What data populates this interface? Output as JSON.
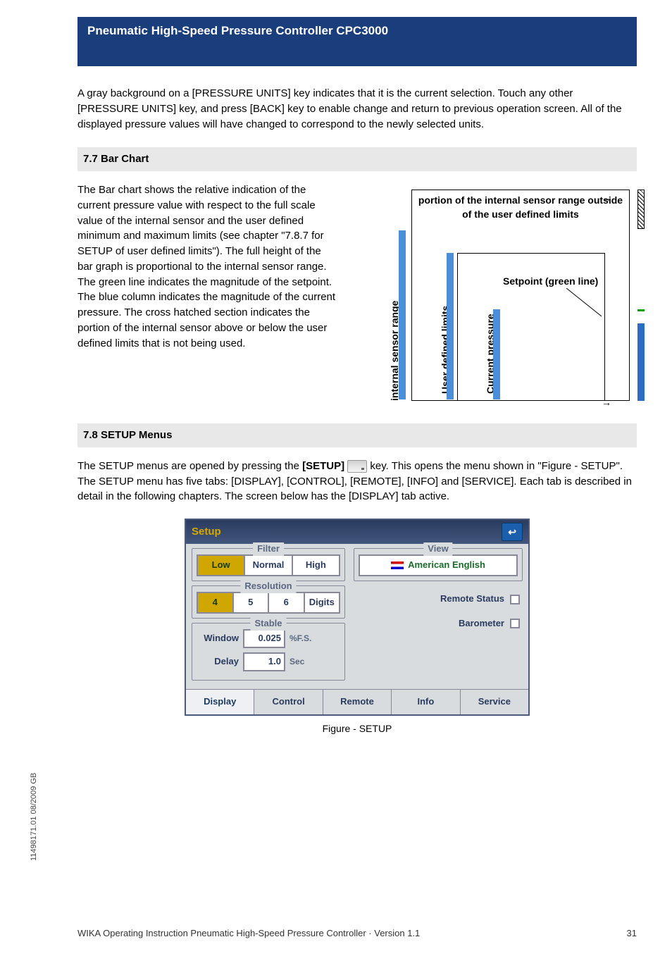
{
  "header": {
    "title": "Pneumatic High-Speed Pressure Controller CPC3000"
  },
  "body": {
    "intro": "A gray background on a [PRESSURE UNITS] key indicates that it is the current selection. Touch any other [PRESSURE UNITS] key, and press [BACK] key to enable change and return to previous operation screen. All of the displayed pressure values will have changed to correspond to the newly selected units.",
    "s77_heading": "7.7 Bar Chart",
    "s77_body": "The Bar chart shows the relative indication of the current pressure value with respect to the full scale value of the internal sensor and the user defined minimum and maximum limits (see chapter \"7.8.7 for SETUP of user defined limits\"). The full height of the bar graph is proportional to the internal sensor range. The green line indicates the magnitude of the setpoint. The blue column indicates the magnitude of the current pressure. The cross hatched section indicates the portion of the internal sensor above or below the user defined limits that is not being used.",
    "diagram": {
      "top": "portion of the internal sensor range outside of the user defined limits",
      "setpoint": "Setpoint (green line)",
      "internal": "internal sensor range",
      "user": "User defined limits",
      "current": "Current pressure"
    },
    "s78_heading": "7.8 SETUP Menus",
    "s78_body_before": "The SETUP menus are opened by pressing the ",
    "s78_body_key": "[SETUP]",
    "s78_body_after": " key. This opens the menu shown in \"Figure - SETUP\". The SETUP menu has five tabs: [DISPLAY], [CONTROL], [REMOTE], [INFO] and [SERVICE]. Each tab is described in detail in the following chapters. The screen below has the [DISPLAY] tab active."
  },
  "setup_ui": {
    "title": "Setup",
    "back_symbol": "↩",
    "filter_label": "Filter",
    "filter_options": [
      "Low",
      "Normal",
      "High"
    ],
    "filter_selected": "Low",
    "resolution_label": "Resolution",
    "resolution_options": [
      "4",
      "5",
      "6",
      "Digits"
    ],
    "resolution_selected": "4",
    "stable_label": "Stable",
    "window_label": "Window",
    "window_value": "0.025",
    "window_unit": "%F.S.",
    "delay_label": "Delay",
    "delay_value": "1.0",
    "delay_unit": "Sec",
    "view_label": "View",
    "language": "American English",
    "remote_status_label": "Remote Status",
    "barometer_label": "Barometer",
    "tabs": [
      "Display",
      "Control",
      "Remote",
      "Info",
      "Service"
    ],
    "active_tab": "Display"
  },
  "figure_caption": "Figure - SETUP",
  "side_docref": "11498171.01 08/2009 GB",
  "footer": {
    "text": "WIKA Operating Instruction Pneumatic High-Speed Pressure Controller · Version 1.1",
    "page": "31"
  }
}
